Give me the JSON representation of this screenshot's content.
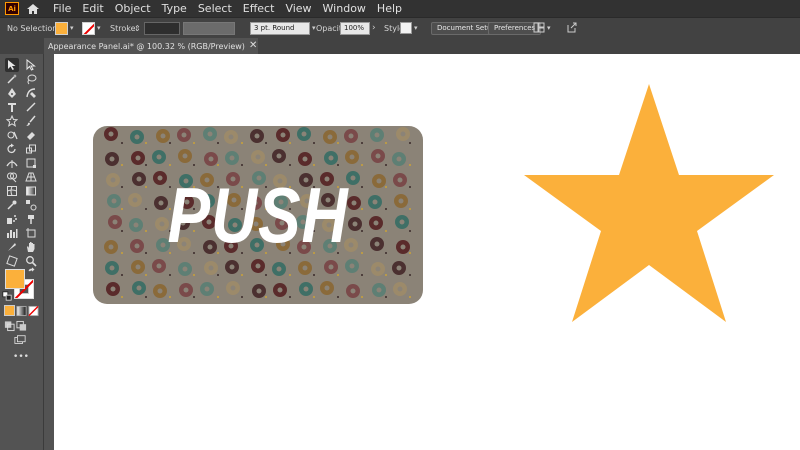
{
  "app": {
    "logo": "Ai"
  },
  "menu": [
    "File",
    "Edit",
    "Object",
    "Type",
    "Select",
    "Effect",
    "View",
    "Window",
    "Help"
  ],
  "control_bar": {
    "selection_label": "No Selection",
    "stroke_label": "Stroke:",
    "stroke_profile": "3 pt. Round",
    "opacity_label": "Opacity:",
    "opacity_value": "100%",
    "style_label": "Style:",
    "document_setup": "Document Setup",
    "preferences": "Preferences",
    "fill_color": "#fbb03b"
  },
  "document_tab": {
    "title": "Appearance Panel.ai* @ 100.32 % (RGB/Preview)",
    "close": "✕"
  },
  "artwork": {
    "button_text": "PUSH",
    "button_bg": "#8b8377",
    "star_color": "#fbb03b"
  },
  "toolbar": {
    "fill_color": "#fbb03b",
    "more_tools": "•••"
  }
}
